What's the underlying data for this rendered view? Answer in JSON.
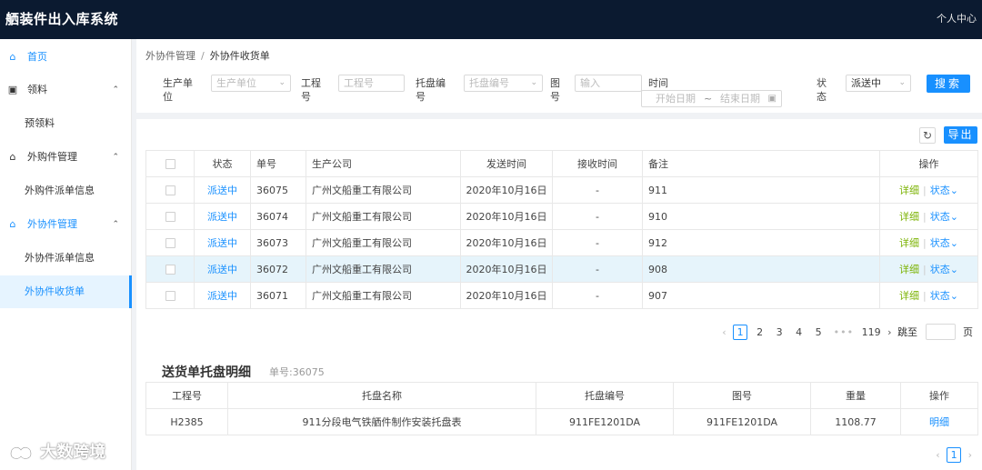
{
  "app": {
    "title": "舾装件出入库系统",
    "user_center": "个人中心"
  },
  "sidebar": {
    "items": [
      {
        "label": "首页",
        "icon": "home-icon",
        "glyph": "⌂"
      },
      {
        "label": "领料",
        "icon": "form-icon",
        "glyph": "▣",
        "arrow": "⌃"
      },
      {
        "label": "预领料"
      },
      {
        "label": "外购件管理",
        "icon": "home-icon",
        "glyph": "⌂",
        "arrow": "⌃"
      },
      {
        "label": "外购件派单信息"
      },
      {
        "label": "外协件管理",
        "icon": "home-icon",
        "glyph": "⌂",
        "arrow": "⌃"
      },
      {
        "label": "外协件派单信息"
      },
      {
        "label": "外协件收货单"
      }
    ]
  },
  "breadcrumb": {
    "parent": "外协件管理",
    "separator": "/",
    "current": "外协件收货单"
  },
  "filters": {
    "producer_label": "生产单位",
    "producer_placeholder": "生产单位",
    "project_label": "工程号",
    "project_placeholder": "工程号",
    "pallet_label": "托盘编号",
    "pallet_placeholder": "托盘编号",
    "drawing_label": "图号",
    "drawing_placeholder": "输入",
    "time_label": "时间",
    "time_start_placeholder": "开始日期",
    "time_range_sep": "~",
    "time_end_placeholder": "结束日期",
    "status_label": "状态",
    "status_value": "派送中",
    "search_label": "搜索"
  },
  "toolbar": {
    "refresh_glyph": "↻",
    "export_label": "导出"
  },
  "list_table": {
    "headers": [
      "状态",
      "单号",
      "生产公司",
      "发送时间",
      "接收时间",
      "备注",
      "操作"
    ],
    "rows": [
      {
        "status": "派送中",
        "number": "36075",
        "company": "广州文船重工有限公司",
        "send_time": "2020年10月16日",
        "receive_time": "-",
        "note": "911"
      },
      {
        "status": "派送中",
        "number": "36074",
        "company": "广州文船重工有限公司",
        "send_time": "2020年10月16日",
        "receive_time": "-",
        "note": "910"
      },
      {
        "status": "派送中",
        "number": "36073",
        "company": "广州文船重工有限公司",
        "send_time": "2020年10月16日",
        "receive_time": "-",
        "note": "912"
      },
      {
        "status": "派送中",
        "number": "36072",
        "company": "广州文船重工有限公司",
        "send_time": "2020年10月16日",
        "receive_time": "-",
        "note": "908"
      },
      {
        "status": "派送中",
        "number": "36071",
        "company": "广州文船重工有限公司",
        "send_time": "2020年10月16日",
        "receive_time": "-",
        "note": "907"
      }
    ],
    "action_detail": "详细",
    "action_status": "状态",
    "action_status_caret": "⌄"
  },
  "pagination": {
    "prev": "‹",
    "next": "›",
    "pages": [
      "1",
      "2",
      "3",
      "4",
      "5"
    ],
    "current": "1",
    "ellipsis": "•••",
    "last": "119",
    "jump_label": "跳至",
    "page_unit": "页"
  },
  "detail": {
    "title": "送货单托盘明细",
    "subtitle": "单号:36075",
    "headers": [
      "工程号",
      "托盘名称",
      "托盘编号",
      "图号",
      "重量",
      "操作"
    ],
    "rows": [
      {
        "project": "H2385",
        "pallet_name": "911分段电气铁舾件制作安装托盘表",
        "pallet_no": "911FE1201DA",
        "drawing_no": "911FE1201DA",
        "weight": "1108.77",
        "action": "明细"
      }
    ]
  },
  "pagination2": {
    "prev": "‹",
    "current": "1",
    "next": "›"
  },
  "watermark": {
    "text": "大数跨境"
  }
}
